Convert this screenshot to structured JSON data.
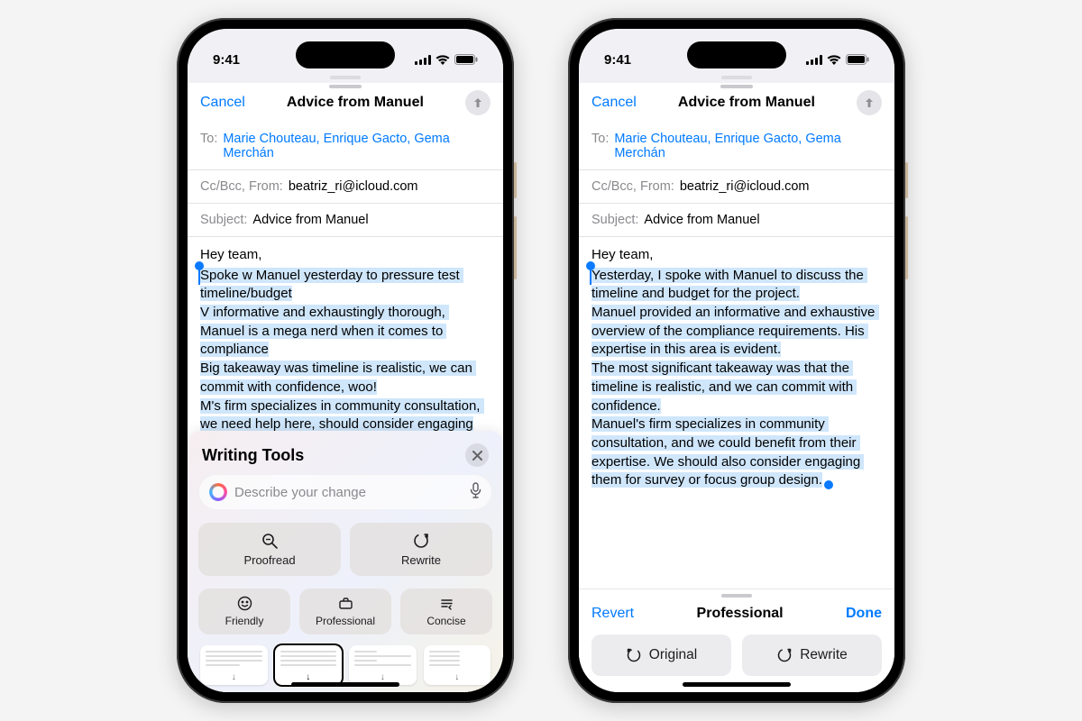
{
  "status": {
    "time": "9:41"
  },
  "compose": {
    "cancel": "Cancel",
    "title": "Advice from Manuel",
    "to_label": "To:",
    "to_names": "Marie Chouteau, Enrique Gacto, Gema Merchán",
    "ccbcc_label": "Cc/Bcc, From:",
    "from_email": "beatriz_ri@icloud.com",
    "subject_label": "Subject:",
    "subject_value": "Advice from Manuel",
    "greeting": "Hey team,"
  },
  "body_left": "Spoke w Manuel yesterday to pressure test timeline/budget\nV informative and exhaustingly thorough, Manuel is a mega nerd when it comes to compliance\nBig takeaway was timeline is realistic, we can commit with confidence, woo!\nM's firm specializes in community consultation, we need help here, should consider engaging",
  "body_right": "Yesterday, I spoke with Manuel to discuss the timeline and budget for the project.\nManuel provided an informative and exhaustive overview of the compliance requirements. His expertise in this area is evident.\nThe most significant takeaway was that the timeline is realistic, and we can commit with confidence.\nManuel's firm specializes in community consultation, and we could benefit from their expertise. We should also consider engaging them for survey or focus group design.",
  "writing_tools": {
    "title": "Writing Tools",
    "placeholder": "Describe your change",
    "tiles": {
      "proofread": "Proofread",
      "rewrite": "Rewrite",
      "friendly": "Friendly",
      "professional": "Professional",
      "concise": "Concise"
    }
  },
  "result": {
    "revert": "Revert",
    "mode": "Professional",
    "done": "Done",
    "original": "Original",
    "rewrite": "Rewrite"
  }
}
